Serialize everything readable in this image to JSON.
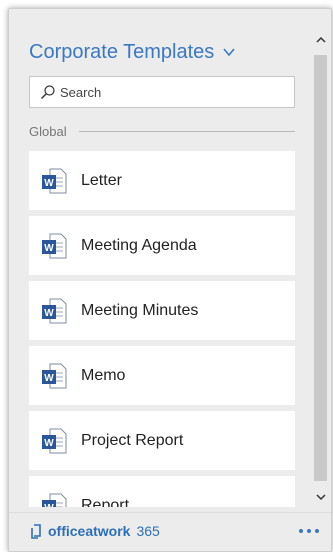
{
  "header": {
    "title": "Corporate Templates"
  },
  "search": {
    "placeholder": "Search"
  },
  "group": {
    "label": "Global"
  },
  "templates": [
    {
      "label": "Letter"
    },
    {
      "label": "Meeting Agenda"
    },
    {
      "label": "Meeting Minutes"
    },
    {
      "label": "Memo"
    },
    {
      "label": "Project Report"
    },
    {
      "label": "Report"
    }
  ],
  "footer": {
    "brand": "officeatwork",
    "version": "365"
  },
  "colors": {
    "accent": "#3b78c2",
    "word_blue": "#2b579a",
    "panel_bg": "#ececec"
  },
  "icons": {
    "title_chevron": "chevron-down-icon",
    "search": "search-icon",
    "template": "word-document-icon",
    "more": "more-icon"
  }
}
